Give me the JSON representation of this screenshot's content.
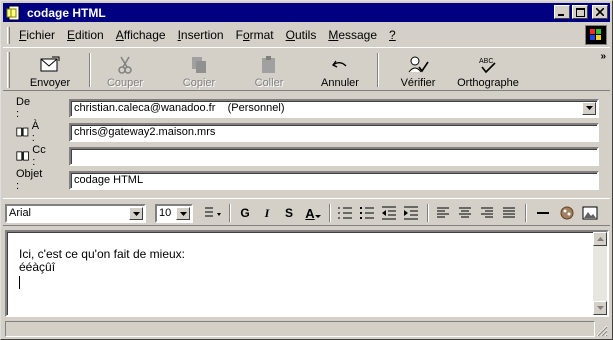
{
  "window": {
    "title": "codage HTML"
  },
  "menu": [
    {
      "label": "Fichier",
      "key": "F"
    },
    {
      "label": "Edition",
      "key": "E"
    },
    {
      "label": "Affichage",
      "key": "A"
    },
    {
      "label": "Insertion",
      "key": "I"
    },
    {
      "label": "Format",
      "key": "o"
    },
    {
      "label": "Outils",
      "key": "O"
    },
    {
      "label": "Message",
      "key": "M"
    },
    {
      "label": "?",
      "key": "?"
    }
  ],
  "toolbar": {
    "send": "Envoyer",
    "cut": "Couper",
    "copy": "Copier",
    "paste": "Coller",
    "undo": "Annuler",
    "check": "Vérifier",
    "spelling": "Orthographe",
    "more": "»"
  },
  "fields": {
    "from_label": "De :",
    "from_value": "christian.caleca@wanadoo.fr    (Personnel)",
    "to_label": "À :",
    "to_value": "chris@gateway2.maison.mrs",
    "cc_label": "Cc :",
    "cc_value": "",
    "subject_label": "Objet :",
    "subject_value": "codage HTML"
  },
  "format": {
    "font": "Arial",
    "size": "10",
    "bold": "G",
    "italic": "I",
    "underline": "S",
    "color": "A"
  },
  "body": {
    "line1": "Ici, c'est ce qu'on fait de mieux:",
    "line2": "ééàçûî"
  },
  "colors": {
    "titlebar": "#000080",
    "face": "#d4d0c8"
  }
}
